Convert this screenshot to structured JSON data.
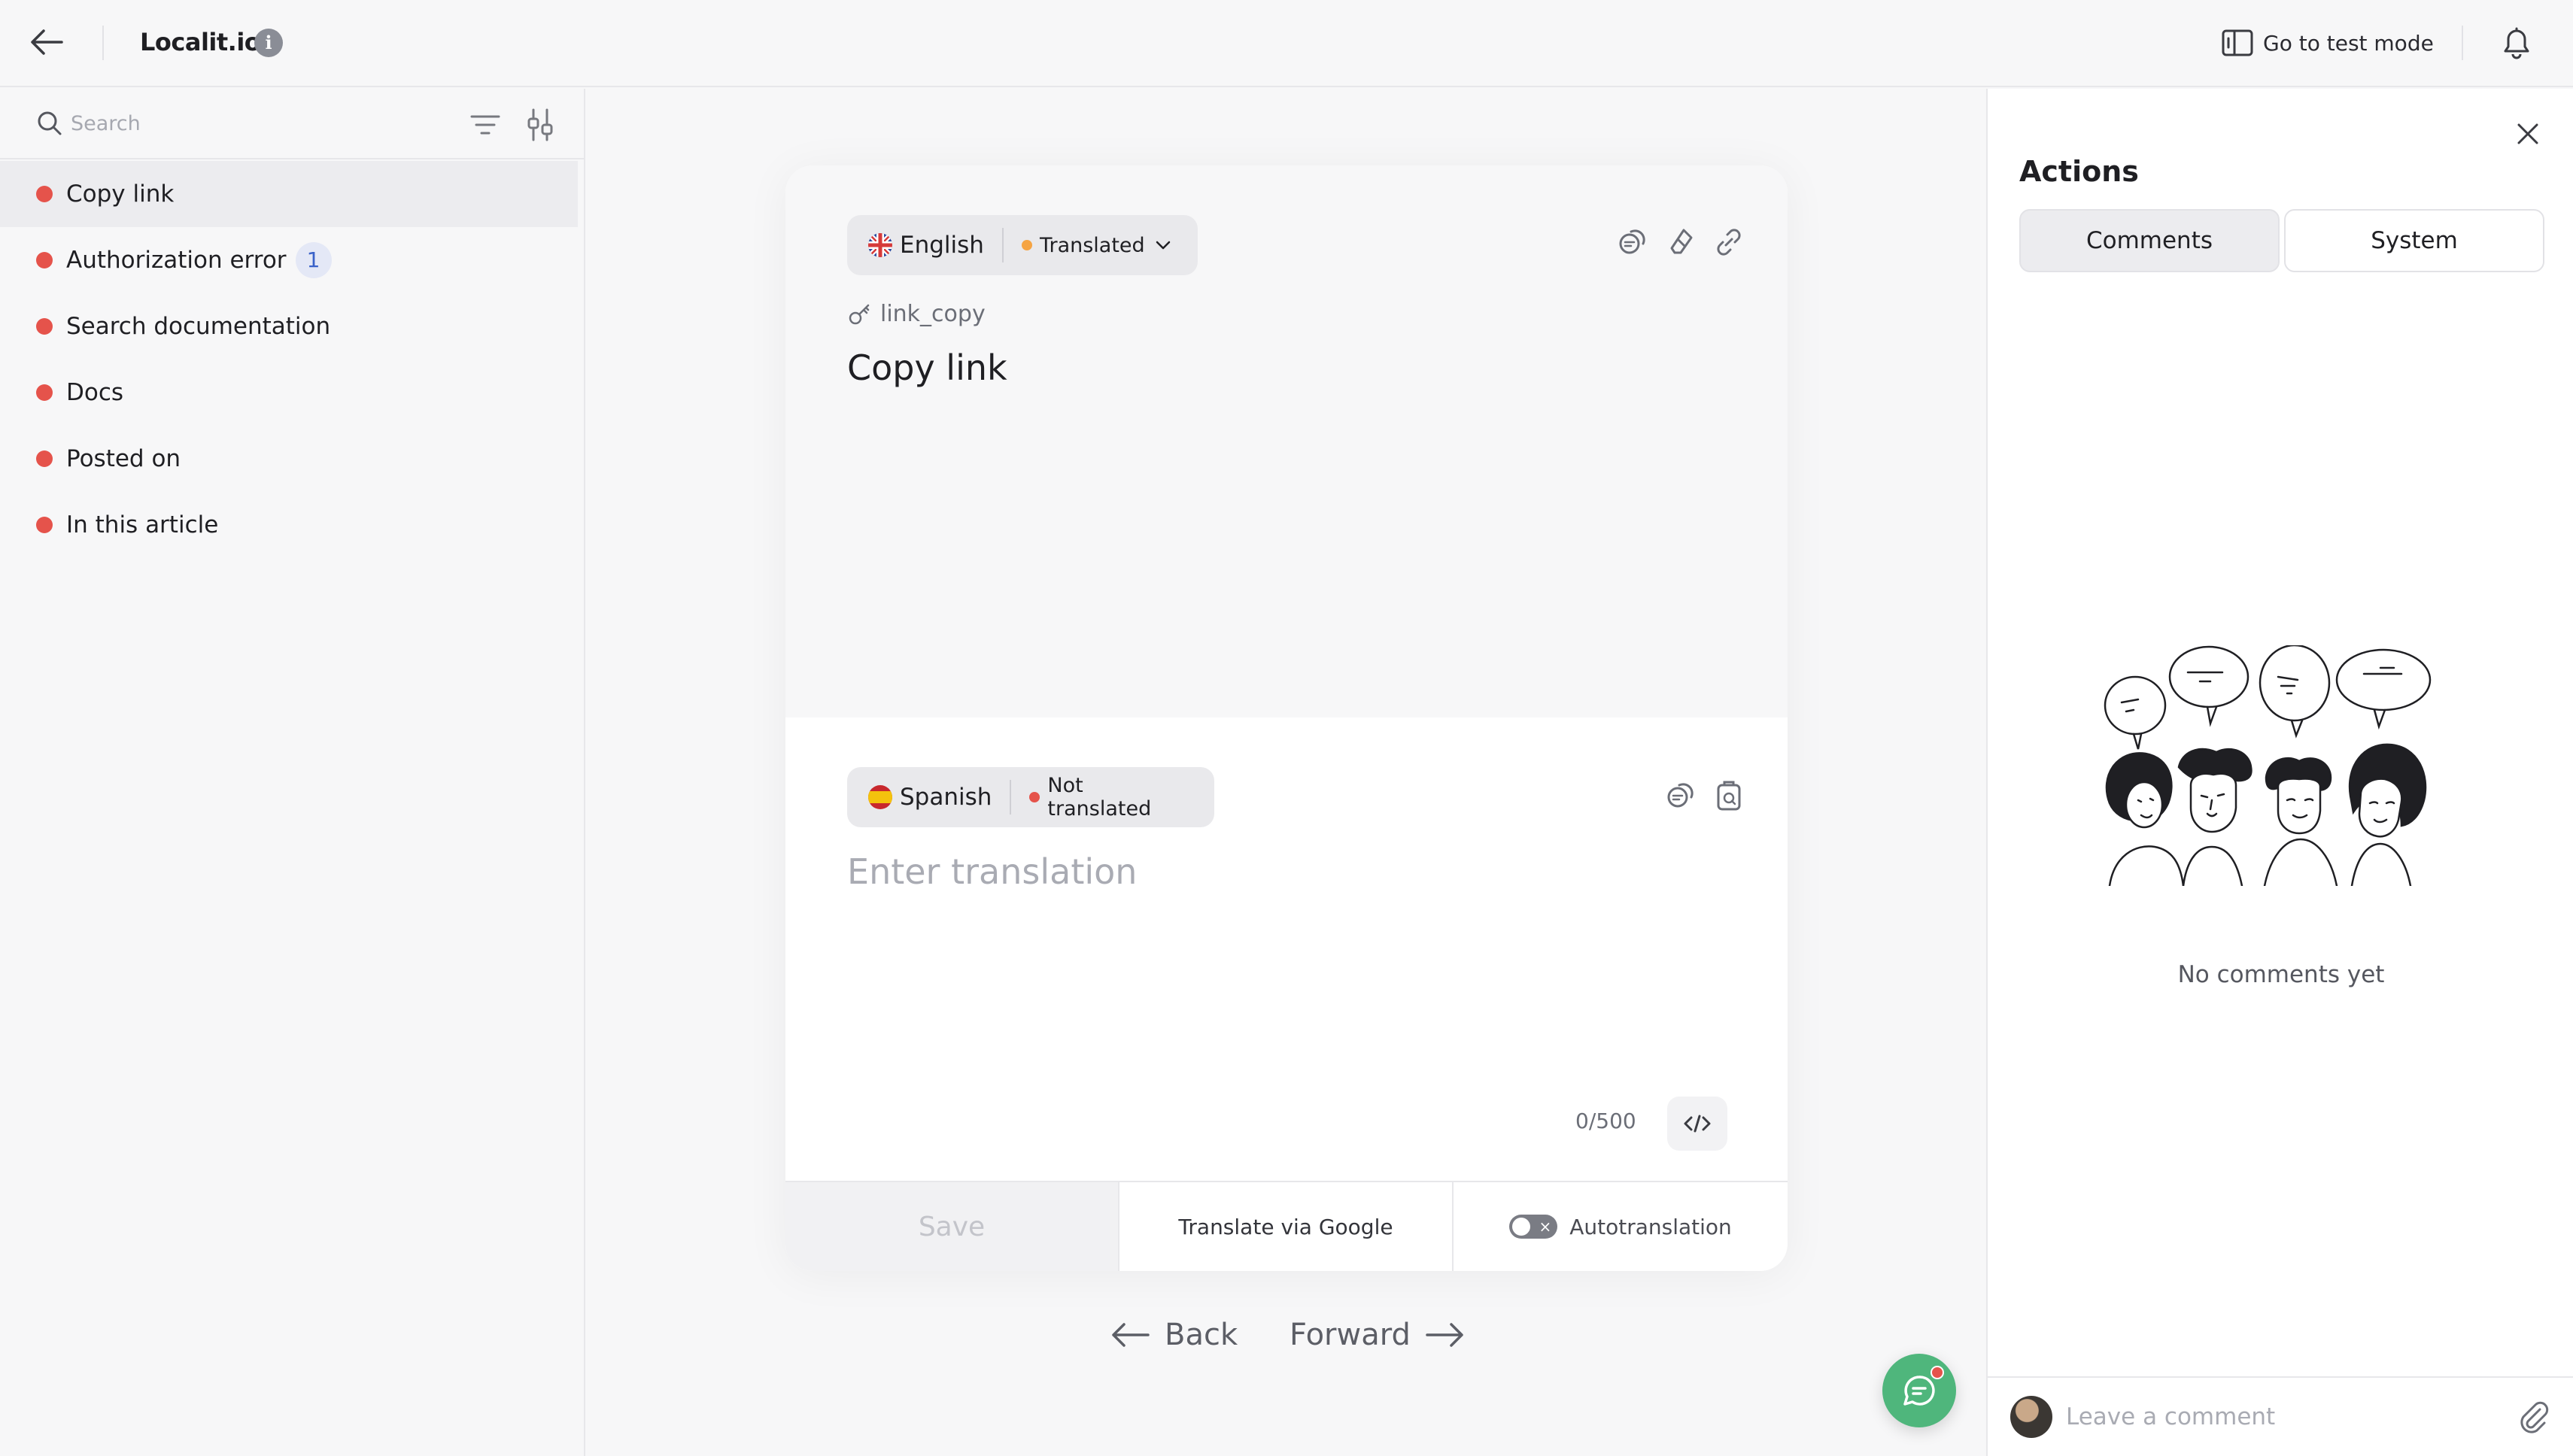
{
  "topbar": {
    "app_title": "Localit.io",
    "info_glyph": "i",
    "test_mode_label": "Go to test mode",
    "icons": [
      "arrow-left-icon",
      "info-icon",
      "test-mode-icon",
      "bell-icon"
    ]
  },
  "sidebar": {
    "search_placeholder": "Search",
    "items": [
      {
        "label": "Copy link",
        "active": true,
        "status_color": "#e5534b"
      },
      {
        "label": "Authorization error",
        "badge": "1",
        "status_color": "#e5534b"
      },
      {
        "label": "Search documentation",
        "status_color": "#e5534b"
      },
      {
        "label": "Docs",
        "status_color": "#e5534b"
      },
      {
        "label": "Posted on",
        "status_color": "#e5534b"
      },
      {
        "label": "In this article",
        "status_color": "#e5534b"
      }
    ]
  },
  "editor": {
    "source": {
      "language": "English",
      "status": "Translated",
      "status_color": "#f5a443",
      "key": "link_copy",
      "text": "Copy link"
    },
    "target": {
      "language": "Spanish",
      "status": "Not translated",
      "status_color": "#e5534b",
      "placeholder": "Enter translation",
      "value": "",
      "char_count": "0/500"
    },
    "footer": {
      "save_label": "Save",
      "google_label": "Translate via Google",
      "autotranslation_label": "Autotranslation",
      "toggle_glyph": "×"
    },
    "nav": {
      "back_label": "Back",
      "forward_label": "Forward"
    }
  },
  "actions_panel": {
    "title": "Actions",
    "tabs": [
      "Comments",
      "System"
    ],
    "active_tab": "Comments",
    "empty_text": "No comments yet",
    "comment_placeholder": "Leave a comment"
  },
  "colors": {
    "accent_green": "#4fb67c",
    "status_red": "#e5534b",
    "status_orange": "#f5a443",
    "badge_blue": "#3a62c9"
  }
}
